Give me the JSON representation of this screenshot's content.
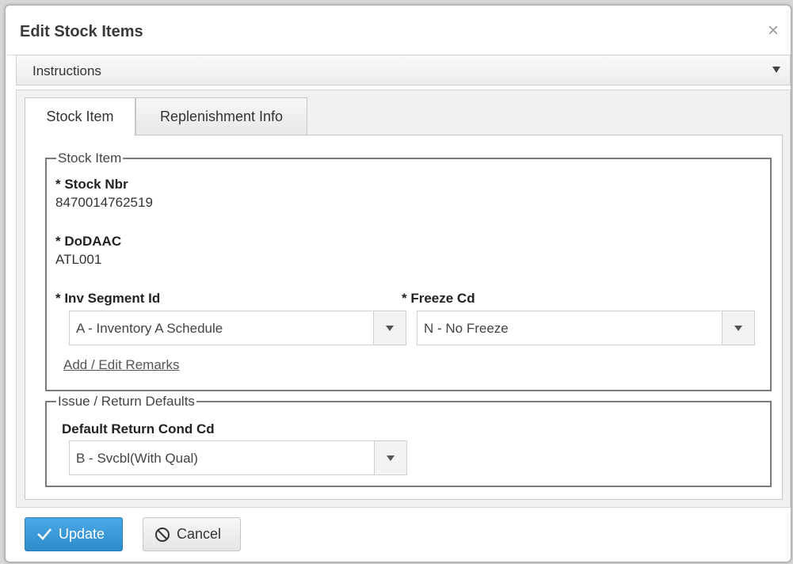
{
  "dialog": {
    "title": "Edit Stock Items",
    "close_glyph": "×"
  },
  "instructions": {
    "label": "Instructions"
  },
  "tabs": [
    {
      "label": "Stock Item",
      "active": true
    },
    {
      "label": "Replenishment Info",
      "active": false
    }
  ],
  "stock_item_group": {
    "legend": "Stock Item",
    "stock_nbr": {
      "label": "* Stock Nbr",
      "value": "8470014762519"
    },
    "dodaac": {
      "label": "* DoDAAC",
      "value": "ATL001"
    },
    "inv_segment": {
      "label": "* Inv Segment Id",
      "selected": "A - Inventory A Schedule"
    },
    "freeze_cd": {
      "label": "* Freeze Cd",
      "selected": "N - No Freeze"
    },
    "remarks_link": "Add / Edit Remarks"
  },
  "issue_return_group": {
    "legend": "Issue / Return Defaults",
    "default_return": {
      "label": "Default Return Cond Cd",
      "selected": "B - Svcbl(With Qual)"
    }
  },
  "buttons": {
    "update": "Update",
    "cancel": "Cancel"
  },
  "icons": {
    "close": "close-icon",
    "instructions_toggle": "triangle-down-icon",
    "update": "checkmark-icon",
    "cancel": "cancel-circle-icon",
    "dropdown": "chevron-down-icon"
  },
  "colors": {
    "primary_button": "#2f8ccb",
    "fieldset_border": "#7a7a7a"
  }
}
